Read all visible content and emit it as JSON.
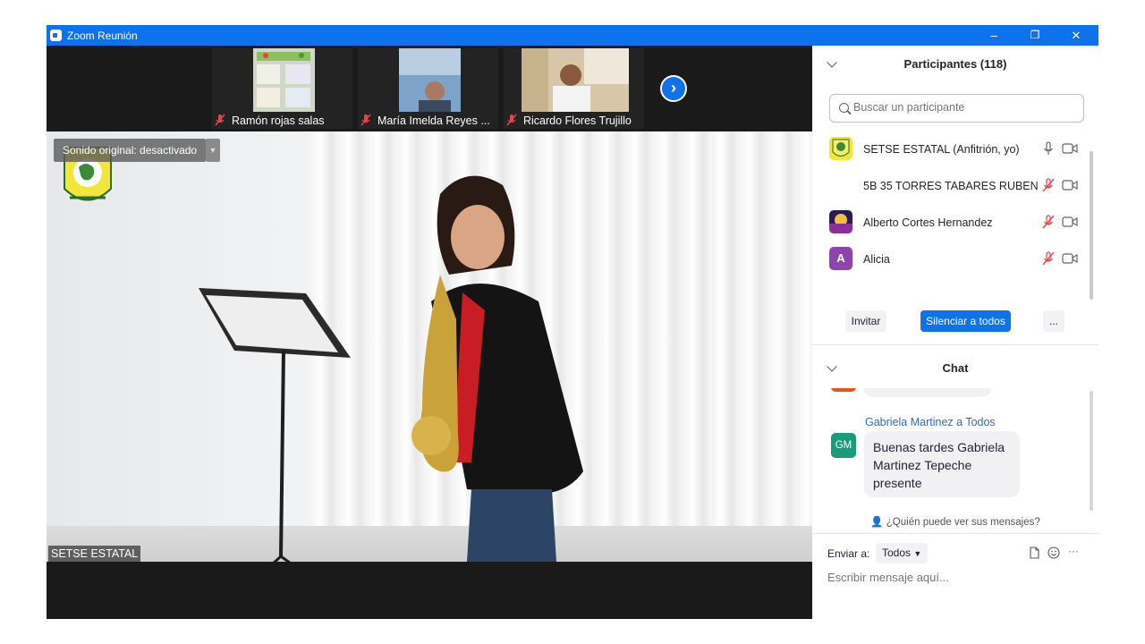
{
  "window": {
    "title": "Zoom Reunión",
    "controls": [
      "–",
      "❐",
      "✕"
    ]
  },
  "thumbnails": [
    {
      "name": "Ramón rojas salas",
      "muted": true
    },
    {
      "name": "María Imelda Reyes ...",
      "muted": true
    },
    {
      "name": "Ricardo Flores Trujillo",
      "muted": true
    }
  ],
  "stage": {
    "sound_label": "Sonido original: desactivado",
    "speaker": "SETSE ESTATAL"
  },
  "participants_panel": {
    "title": "Participantes (118)",
    "search_placeholder": "Buscar un participante",
    "participants": [
      {
        "name": "SETSE ESTATAL (Anfitrión, yo)",
        "mic": "on"
      },
      {
        "name": "5B 35 TORRES TABARES RUBEN ...",
        "mic": "muted"
      },
      {
        "name": "Alberto Cortes Hernandez",
        "mic": "muted"
      },
      {
        "name": "Alicia",
        "mic": "muted",
        "initial": "A"
      }
    ],
    "buttons": {
      "invite": "Invitar",
      "mute_all": "Silenciar a todos",
      "more": "..."
    }
  },
  "chat_panel": {
    "title": "Chat",
    "message": {
      "sender": "Gabriela Martinez a Todos",
      "initials": "GM",
      "text": "Buenas tardes Gabriela Martinez Tepeche presente"
    },
    "who_can_see": "¿Quién puede ver sus mensajes?",
    "send_to_label": "Enviar a:",
    "send_to_value": "Todos",
    "input_placeholder": "Escribir mensaje aquí...",
    "more": "···"
  },
  "colors": {
    "accent": "#0e72ed",
    "muted_red": "#e0474c",
    "gm_avatar": "#1a9b7a",
    "alicia_avatar": "#8e44ad"
  }
}
